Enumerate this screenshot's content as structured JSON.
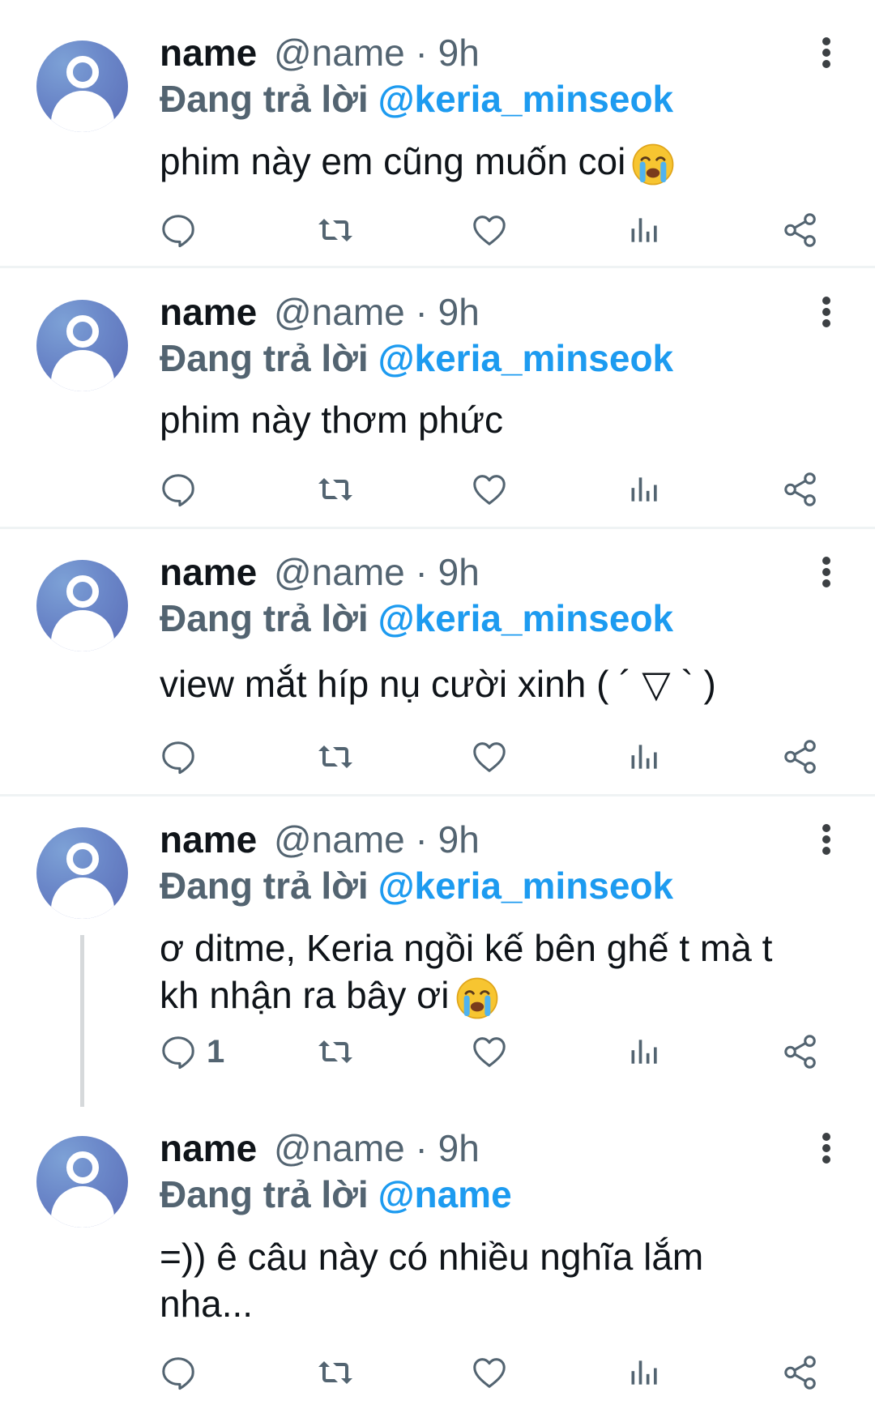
{
  "colors": {
    "accent": "#1d9bf0",
    "muted": "#536471",
    "text": "#0f1419"
  },
  "tweets": [
    {
      "display_name": "name",
      "handle": "@name",
      "dot": "·",
      "time": "9h",
      "reply_label": "Đang trả lời",
      "reply_to": "@keria_minseok",
      "text": "phim này em cũng muốn coi",
      "emoji": "loudly-crying-face",
      "reply_count": ""
    },
    {
      "display_name": "name",
      "handle": "@name",
      "dot": "·",
      "time": "9h",
      "reply_label": "Đang trả lời",
      "reply_to": "@keria_minseok",
      "text": "phim này thơm phức",
      "reply_count": ""
    },
    {
      "display_name": "name",
      "handle": "@name",
      "dot": "·",
      "time": "9h",
      "reply_label": "Đang trả lời",
      "reply_to": "@keria_minseok",
      "text": "view mắt híp nụ cười xinh ( ´ ▽ ` )",
      "reply_count": ""
    },
    {
      "display_name": "name",
      "handle": "@name",
      "dot": "·",
      "time": "9h",
      "reply_label": "Đang trả lời",
      "reply_to": "@keria_minseok",
      "text_line1": "ơ ditme, Keria ngồi kế bên ghế t mà t",
      "text_line2": "kh nhận ra bây ơi",
      "emoji": "loudly-crying-face",
      "reply_count": "1"
    },
    {
      "display_name": "name",
      "handle": "@name",
      "dot": "·",
      "time": "9h",
      "reply_label": "Đang trả lời",
      "reply_to": "@name",
      "text_line1": "=)) ê câu này có nhiều nghĩa lắm",
      "text_line2": "nha...",
      "reply_count": ""
    }
  ],
  "icons": [
    "reply-icon",
    "retweet-icon",
    "like-icon",
    "views-icon",
    "share-icon",
    "more-icon"
  ]
}
